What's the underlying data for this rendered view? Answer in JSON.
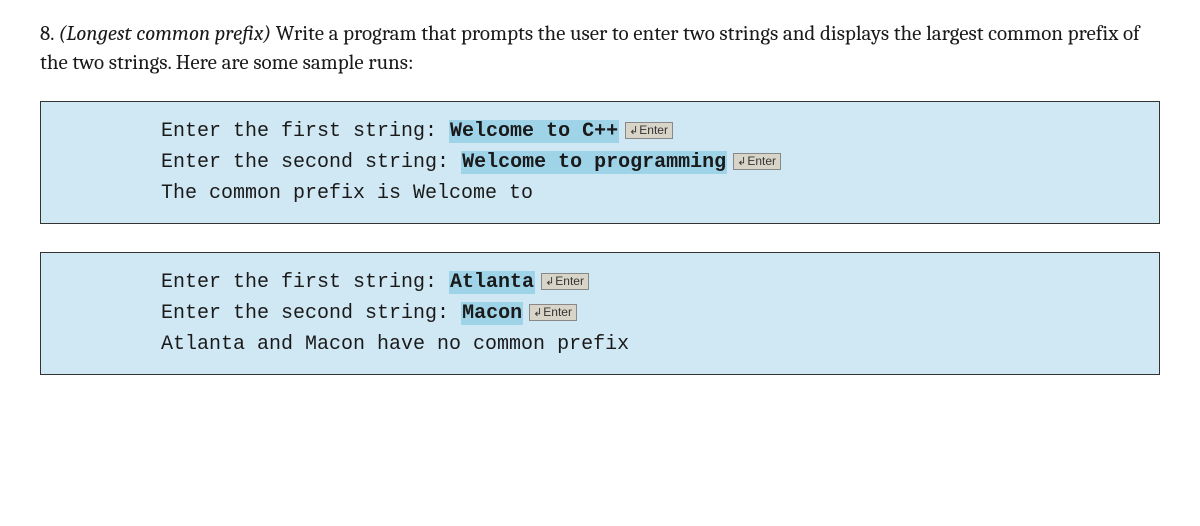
{
  "problem": {
    "number": "8.",
    "title_italic": "(Longest common prefix)",
    "body": " Write a program that prompts the user to enter two strings and displays the largest common prefix of the two strings. Here are some sample runs:"
  },
  "enter_key": {
    "arrow": "↲",
    "label": "Enter"
  },
  "sample1": {
    "line1_prompt": "Enter the first string: ",
    "line1_input": "Welcome to C++",
    "line2_prompt": "Enter the second string: ",
    "line2_input": "Welcome to programming",
    "line3": "The common prefix is Welcome to"
  },
  "sample2": {
    "line1_prompt": "Enter the first string: ",
    "line1_input": "Atlanta",
    "line2_prompt": "Enter the second string: ",
    "line2_input": "Macon",
    "line3": "Atlanta and Macon have no common prefix"
  }
}
